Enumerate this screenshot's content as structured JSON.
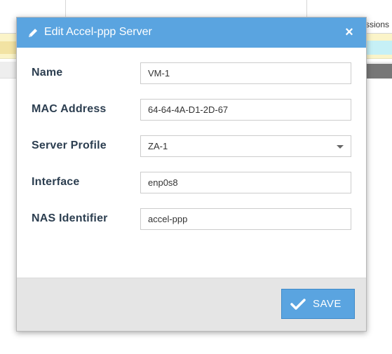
{
  "background": {
    "columns_header_partial": "ssions"
  },
  "modal": {
    "title": "Edit Accel-ppp Server",
    "close_symbol": "×",
    "header_icon": "pencil-icon",
    "fields": {
      "name": {
        "label": "Name",
        "value": "VM-1"
      },
      "mac": {
        "label": "MAC Address",
        "value": "64-64-4A-D1-2D-67"
      },
      "profile": {
        "label": "Server Profile",
        "value": "ZA-1"
      },
      "interface": {
        "label": "Interface",
        "value": "enp0s8"
      },
      "nas": {
        "label": "NAS Identifier",
        "value": "accel-ppp"
      }
    },
    "save_label": "SAVE",
    "save_icon": "checkmark-icon"
  },
  "colors": {
    "header_bg": "#5aa4e0",
    "save_bg": "#5aa4e0",
    "label_text": "#2c3e50",
    "footer_bg": "#e5e5e5"
  }
}
